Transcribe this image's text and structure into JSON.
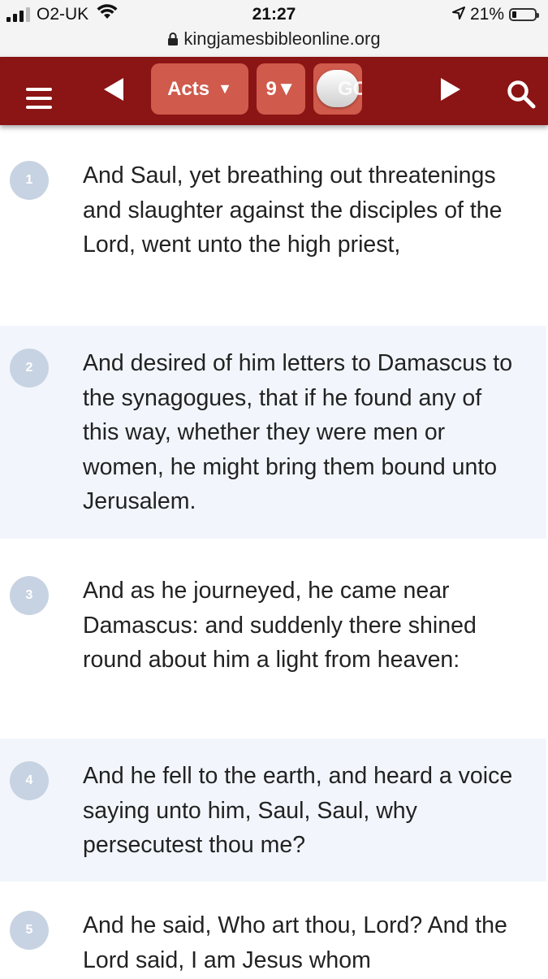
{
  "status_bar": {
    "carrier": "O2-UK",
    "time": "21:27",
    "battery": "21%",
    "battery_level": 0.21
  },
  "url_bar": {
    "url": "kingjamesbibleonline.org"
  },
  "nav": {
    "book_label": "Acts",
    "book_caret": "▼",
    "chapter_label": "9▼",
    "go_label": "GO",
    "colors": {
      "bar": "#8b1414",
      "pill": "#d05a4c"
    }
  },
  "verses": [
    {
      "number": "1",
      "text": "And Saul, yet breathing out threatenings and slaughter against the disciples of the Lord, went unto the high priest,"
    },
    {
      "number": "2",
      "text": "And desired of him letters to Damascus to the synagogues, that if he found any of this way, whether they were men or women, he might bring them bound unto Jerusalem."
    },
    {
      "number": "3",
      "text": "And as he journeyed, he came near Damascus: and suddenly there shined round about him a light from heaven:"
    },
    {
      "number": "4",
      "text": "And he fell to the earth, and heard a voice saying unto him, Saul, Saul, why persecutest thou me?"
    },
    {
      "number": "5",
      "text": "And he said, Who art thou, Lord? And the Lord said, I am Jesus whom"
    }
  ]
}
